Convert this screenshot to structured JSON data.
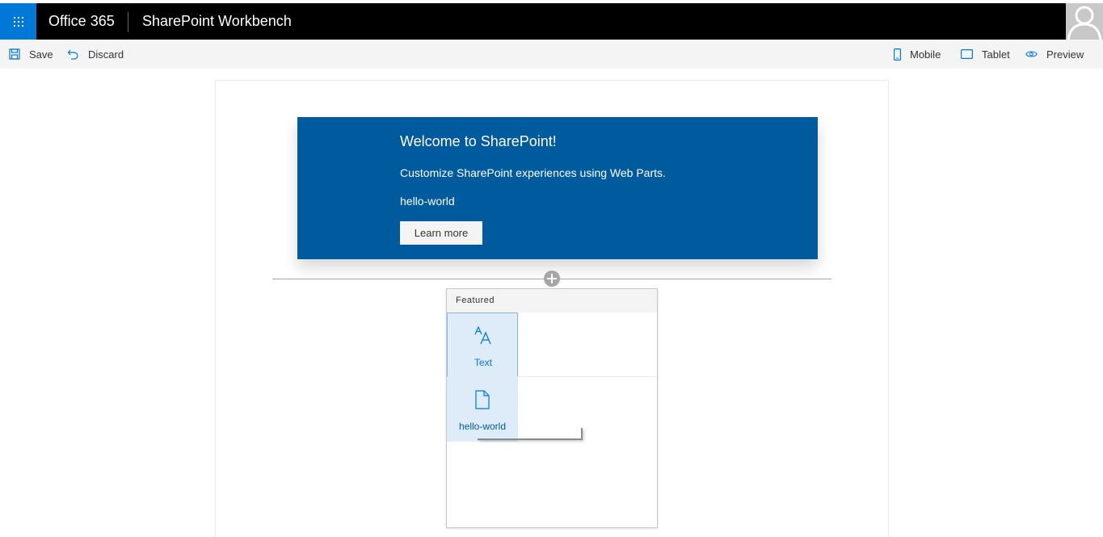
{
  "suite_bar": {
    "brand": "Office 365",
    "app_title": "SharePoint Workbench",
    "waffle_icon": "waffle-icon",
    "avatar_icon": "person-icon",
    "accent_color": "#0078d7"
  },
  "command_bar": {
    "save_label": "Save",
    "discard_label": "Discard",
    "mobile_label": "Mobile",
    "tablet_label": "Tablet",
    "preview_label": "Preview"
  },
  "hero": {
    "title": "Welcome to SharePoint!",
    "subtitle": "Customize SharePoint experiences using Web Parts.",
    "description": "hello-world",
    "button_label": "Learn more",
    "background_color": "#005a9e"
  },
  "toolbox": {
    "header": "Featured",
    "items": [
      {
        "label": "Text",
        "icon": "font-size-icon"
      },
      {
        "label": "hello-world",
        "icon": "page-icon"
      }
    ]
  }
}
